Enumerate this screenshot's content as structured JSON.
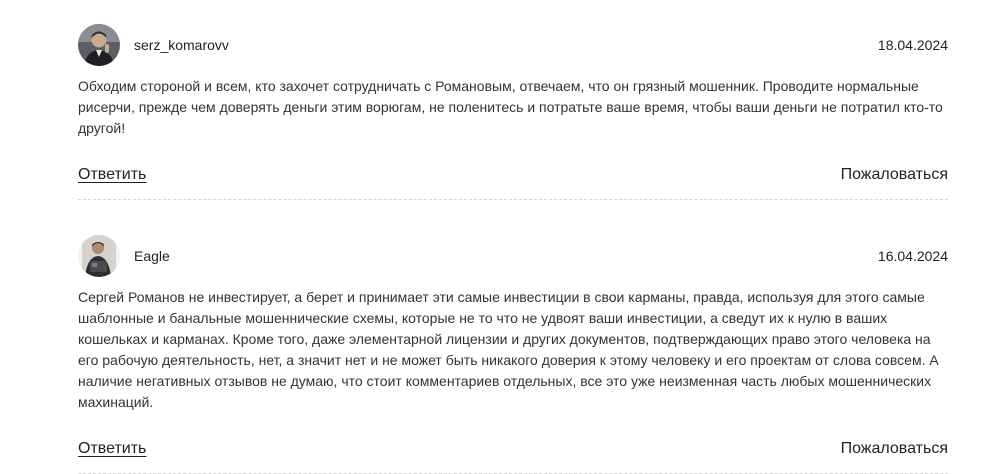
{
  "comments": [
    {
      "username": "serz_komarovv",
      "avatar_icon": "user-photo-icon",
      "date": "18.04.2024",
      "text": "Обходим стороной и всем, кто захочет сотрудничать с Романовым, отвечаем, что он грязный мошенник. Проводите нормальные\nрисерчи, прежде чем доверять деньги этим ворюгам, не поленитесь и потратьте ваше время, чтобы ваши деньги не потратил кто-то\nдругой!",
      "reply_label": "Ответить",
      "report_label": "Пожаловаться"
    },
    {
      "username": "Eagle",
      "avatar_icon": "user-photo-icon",
      "date": "16.04.2024",
      "text": "Сергей Романов не инвестирует, а берет и принимает эти самые инвестиции в свои карманы, правда, используя для этого самые\nшаблонные и банальные мошеннические схемы, которые не то что не удвоят ваши инвестиции, а сведут их к нулю в ваших\nкошельках и карманах. Кроме того, даже элементарной лицензии и других документов, подтверждающих право этого человека на\nего рабочую деятельность, нет, а значит нет и не может быть никакого доверия к этому человеку и его проектам от слова совсем. А\nналичие негативных отзывов не думаю, что стоит комментариев отдельных, все это уже неизменная часть любых мошеннических\nмахинаций.",
      "reply_label": "Ответить",
      "report_label": "Пожаловаться"
    }
  ]
}
